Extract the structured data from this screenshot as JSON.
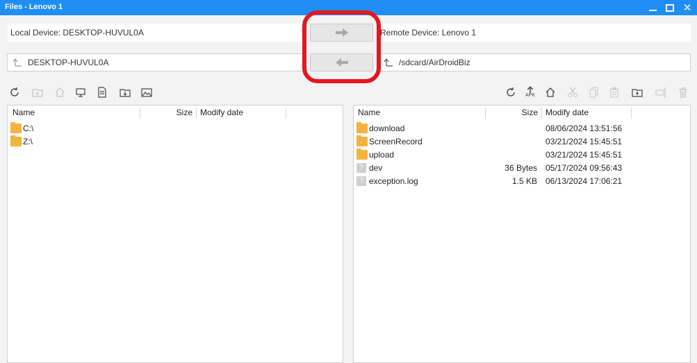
{
  "window": {
    "title": "Files - Lenovo 1",
    "close_glyph": "✕"
  },
  "local": {
    "device_label": "Local Device: DESKTOP-HUVUL0A",
    "path": "DESKTOP-HUVUL0A",
    "columns": {
      "name": "Name",
      "size": "Size",
      "modified": "Modify date"
    },
    "items": [
      {
        "name": "C:\\",
        "type": "folder"
      },
      {
        "name": "Z:\\",
        "type": "folder"
      }
    ]
  },
  "remote": {
    "device_label": "Remote Device: Lenovo 1",
    "path": "/sdcard/AirDroidBiz",
    "columns": {
      "name": "Name",
      "size": "Size",
      "modified": "Modify date"
    },
    "items": [
      {
        "name": "download",
        "type": "folder",
        "size": "",
        "modified": "08/06/2024 13:51:56"
      },
      {
        "name": "ScreenRecord",
        "type": "folder",
        "size": "",
        "modified": "03/21/2024 15:45:51"
      },
      {
        "name": "upload",
        "type": "folder",
        "size": "",
        "modified": "03/21/2024 15:45:51"
      },
      {
        "name": "dev",
        "type": "file",
        "size": "36 Bytes",
        "modified": "05/17/2024 09:56:43"
      },
      {
        "name": "exception.log",
        "type": "file",
        "size": "1.5 KB",
        "modified": "06/13/2024 17:06:21"
      }
    ]
  },
  "toolbar": {
    "apk_label": "APK",
    "unknown_file_glyph": "?"
  },
  "colors": {
    "titlebar": "#1e8ef5",
    "highlight": "#e3171f",
    "folder": "#f4b23e"
  }
}
